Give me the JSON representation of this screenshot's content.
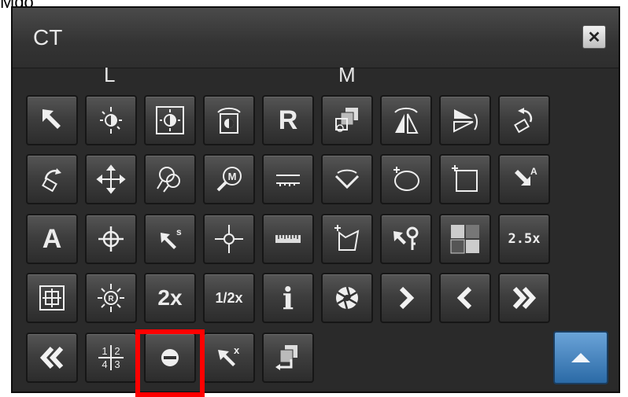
{
  "cut_text": "Mdo",
  "window": {
    "title": "CT",
    "close_label": "✕"
  },
  "columns": {
    "left": "L",
    "middle": "M"
  },
  "labels": {
    "r": "R",
    "a": "A",
    "s": "s",
    "m": "M",
    "x2": "2x",
    "half": "1/2x",
    "info": "i",
    "zoom25": "2.5x",
    "ax": "A",
    "xmark": "x",
    "layout": [
      "1",
      "2",
      "4",
      "3"
    ]
  },
  "selected_tool": "line-cut-button",
  "colors": {
    "panel": "#2a2a2a",
    "highlight": "#ff0000",
    "accent": "#2b6aa6"
  }
}
